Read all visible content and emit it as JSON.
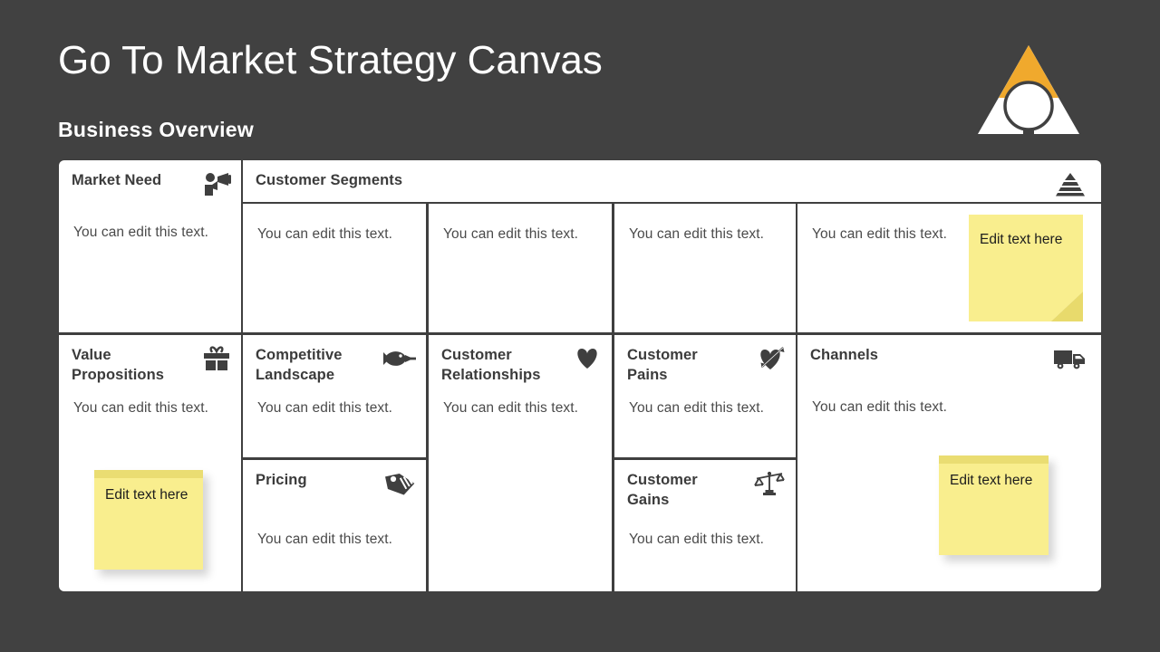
{
  "slide": {
    "title": "Go To Market Strategy Canvas",
    "subtitle": "Business Overview",
    "background_color": "#414141",
    "card_color": "#ffffff",
    "accent_color": "#F0A92D",
    "sticky_color": "#F9EE8E",
    "text_color": "#3B3B3B"
  },
  "logo": {
    "name": "triangle-circle-logo",
    "triangle_top_color": "#F0A92D",
    "triangle_base_color": "#FFFFFF"
  },
  "canvas": {
    "cells": [
      {
        "id": "market-need",
        "title": "Market Need",
        "icon": "megaphone-person-icon",
        "body": "You can edit this text."
      },
      {
        "id": "customer-segments",
        "title": "Customer Segments",
        "icon": "pyramid-icon",
        "body": ""
      },
      {
        "id": "segment-1",
        "title": "",
        "icon": "",
        "body": "You can edit this text."
      },
      {
        "id": "segment-2",
        "title": "",
        "icon": "",
        "body": "You can edit this text."
      },
      {
        "id": "segment-3",
        "title": "",
        "icon": "",
        "body": "You can edit this text."
      },
      {
        "id": "segment-4",
        "title": "",
        "icon": "",
        "body": "You can edit this text."
      },
      {
        "id": "value-propositions",
        "title": "Value Propositions",
        "icon": "gift-icon",
        "body": "You can edit this text."
      },
      {
        "id": "competitive-landscape",
        "title": "Competitive Landscape",
        "icon": "fish-icon",
        "body": "You can edit this text."
      },
      {
        "id": "pricing",
        "title": "Pricing",
        "icon": "price-tag-icon",
        "body": "You can edit this text."
      },
      {
        "id": "customer-relationships",
        "title": "Customer Relationships",
        "icon": "heart-icon",
        "body": "You can edit this text."
      },
      {
        "id": "customer-pains",
        "title": "Customer Pains",
        "icon": "heart-arrow-icon",
        "body": "You can edit this text."
      },
      {
        "id": "customer-gains",
        "title": "Customer Gains",
        "icon": "balance-scales-icon",
        "body": "You can edit this text."
      },
      {
        "id": "channels",
        "title": "Channels",
        "icon": "delivery-truck-icon",
        "body": "You can edit this text."
      }
    ],
    "sticky_notes": [
      {
        "id": "sticky-segments",
        "text": "Edit text here"
      },
      {
        "id": "sticky-value-propositions",
        "text": "Edit text here"
      },
      {
        "id": "sticky-channels",
        "text": "Edit text here"
      }
    ]
  }
}
